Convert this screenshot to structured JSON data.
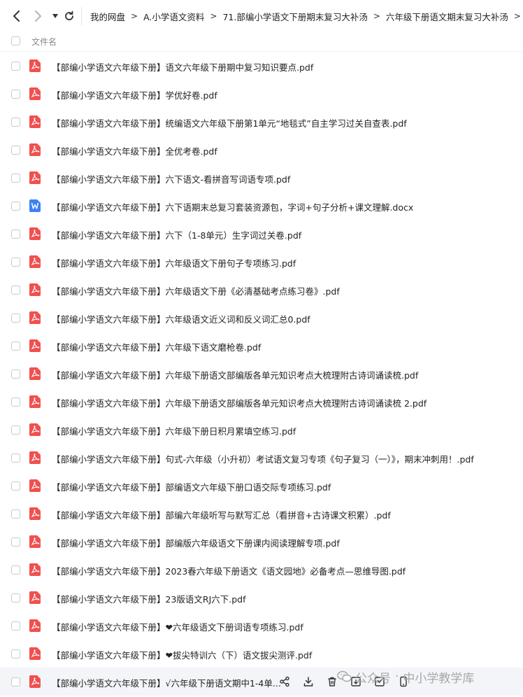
{
  "nav": {
    "back_icon": "chevron-left-icon",
    "forward_icon": "chevron-right-icon",
    "dropdown_icon": "caret-down-icon",
    "refresh_icon": "refresh-icon"
  },
  "breadcrumb": [
    "我的网盘",
    "A.小学语文资料",
    "71.部编小学语文下册期末复习大补汤",
    "六年级下册语文期末复习大补汤"
  ],
  "breadcrumb_separator": ">",
  "list_header": {
    "name_column": "文件名"
  },
  "files": [
    {
      "name": "【部编小学语文六年级下册】语文六年级下册期中复习知识要点.pdf",
      "type": "pdf"
    },
    {
      "name": "【部编小学语文六年级下册】学优好卷.pdf",
      "type": "pdf"
    },
    {
      "name": "【部编小学语文六年级下册】统编语文六年级下册第1单元“地毯式”自主学习过关自查表.pdf",
      "type": "pdf"
    },
    {
      "name": "【部编小学语文六年级下册】全优考卷.pdf",
      "type": "pdf"
    },
    {
      "name": "【部编小学语文六年级下册】六下语文-看拼音写词语专项.pdf",
      "type": "pdf"
    },
    {
      "name": "【部编小学语文六年级下册】六下语期末总复习套装资源包，字词+句子分析+课文理解.docx",
      "type": "docx"
    },
    {
      "name": "【部编小学语文六年级下册】六下（1-8单元）生字词过关卷.pdf",
      "type": "pdf"
    },
    {
      "name": "【部编小学语文六年级下册】六年级语文下册句子专项练习.pdf",
      "type": "pdf"
    },
    {
      "name": "【部编小学语文六年级下册】六年级语文下册《必清基础考点练习卷》.pdf",
      "type": "pdf"
    },
    {
      "name": "【部编小学语文六年级下册】六年级语文近义词和反义词汇总0.pdf",
      "type": "pdf"
    },
    {
      "name": "【部编小学语文六年级下册】六年级下语文磨枪卷.pdf",
      "type": "pdf"
    },
    {
      "name": "【部编小学语文六年级下册】六年级下册语文部编版各单元知识考点大梳理附古诗词诵读梳.pdf",
      "type": "pdf"
    },
    {
      "name": "【部编小学语文六年级下册】六年级下册语文部编版各单元知识考点大梳理附古诗词诵读梳 2.pdf",
      "type": "pdf"
    },
    {
      "name": "【部编小学语文六年级下册】六年级下册日积月累填空练习.pdf",
      "type": "pdf"
    },
    {
      "name": "【部编小学语文六年级下册】句式-六年级（小升初）考试语文复习专项《句子复习（一）》，期末冲刺用！.pdf",
      "type": "pdf"
    },
    {
      "name": "【部编小学语文六年级下册】部编语文六年级下册口语交际专项练习.pdf",
      "type": "pdf"
    },
    {
      "name": "【部编小学语文六年级下册】部编六年级听写与默写汇总（看拼音+古诗课文积累）.pdf",
      "type": "pdf"
    },
    {
      "name": "【部编小学语文六年级下册】部编版六年级语文下册课内阅读理解专项.pdf",
      "type": "pdf"
    },
    {
      "name": "【部编小学语文六年级下册】2023春六年级下册语文《语文园地》必备考点—思维导图.pdf",
      "type": "pdf"
    },
    {
      "name": "【部编小学语文六年级下册】23版语文RJ六下.pdf",
      "type": "pdf"
    },
    {
      "name": "【部编小学语文六年级下册】❤六年级语文下册词语专项练习.pdf",
      "type": "pdf"
    },
    {
      "name": "【部编小学语文六年级下册】❤拔尖特训六（下）语文拔尖测评.pdf",
      "type": "pdf"
    },
    {
      "name": "【部编小学语文六年级下册】√六年级下册语文期中1-4单...",
      "type": "pdf",
      "hover": true
    }
  ],
  "row_actions": [
    "share-icon",
    "download-icon",
    "delete-icon",
    "move-icon",
    "copy-icon",
    "phone-icon"
  ],
  "watermark": {
    "prefix": "公众号",
    "dot": "·",
    "name": "中小学教学库"
  },
  "colors": {
    "pdf": "#f0504f",
    "docx": "#3b82f6",
    "hover_bg": "#f3f5f8",
    "watermark": "#a8a8a8"
  }
}
